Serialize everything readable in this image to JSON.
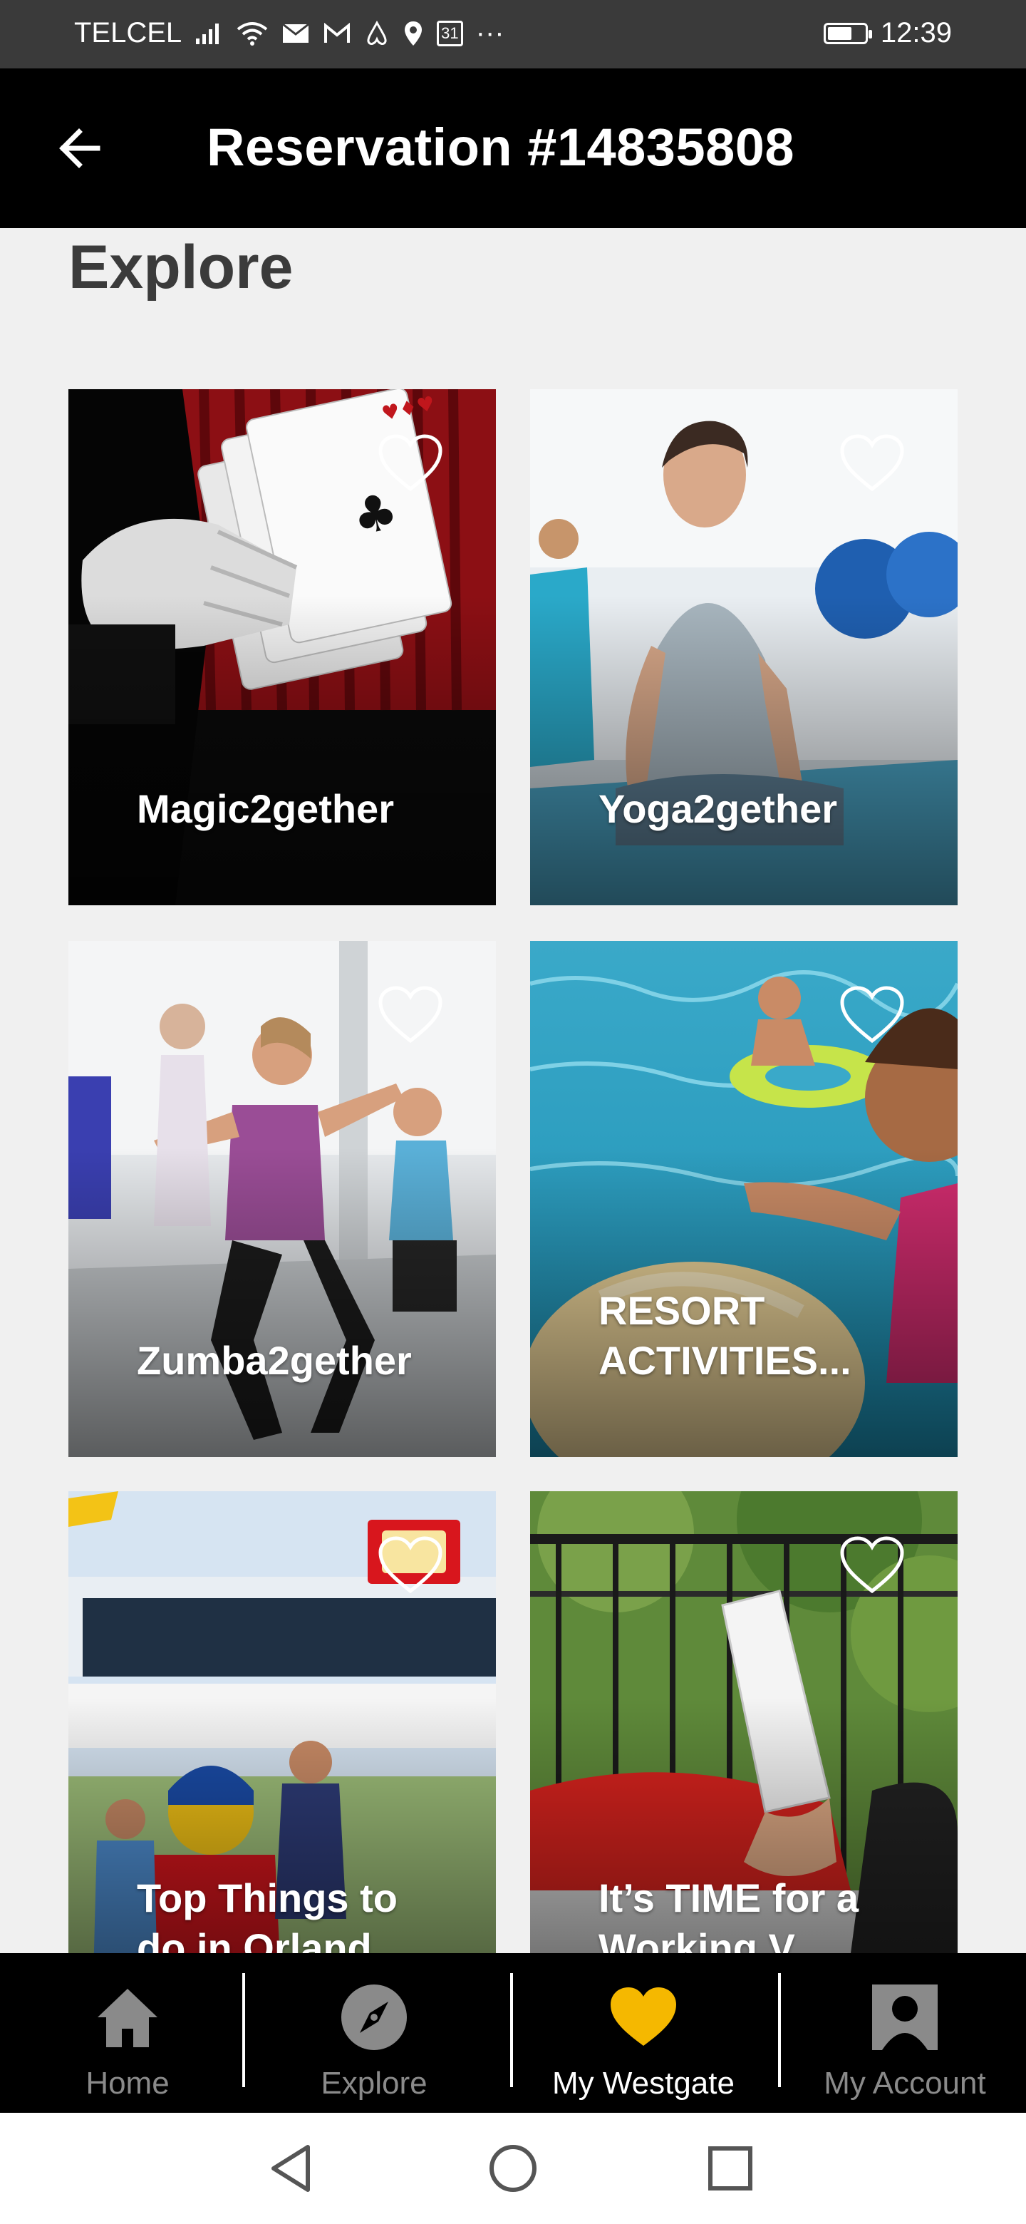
{
  "status_bar": {
    "carrier": "TELCEL",
    "calendar_day": "31",
    "overflow": "···",
    "time": "12:39",
    "battery_level": 0.6
  },
  "app_bar": {
    "title": "Reservation #14835808",
    "back_icon": "arrow-left-icon"
  },
  "explore": {
    "heading": "Explore",
    "cards": [
      {
        "label": "Magic2gether",
        "image": "magician-cards-photo",
        "favorite_icon": "heart-outline-icon"
      },
      {
        "label": "Yoga2gether",
        "image": "yoga-class-photo",
        "favorite_icon": "heart-outline-icon"
      },
      {
        "label": "Zumba2gether",
        "image": "zumba-dance-photo",
        "favorite_icon": "heart-outline-icon"
      },
      {
        "label": "RESORT ACTIVITIES...",
        "image": "pool-kids-photo",
        "favorite_icon": "heart-outline-icon"
      },
      {
        "label": "Top Things to do in Orland...",
        "image": "legoland-photo",
        "favorite_icon": "heart-outline-icon"
      },
      {
        "label": "It’s TIME for a Working V...",
        "image": "reading-balcony-photo",
        "favorite_icon": "heart-outline-icon"
      }
    ]
  },
  "bottom_nav": {
    "items": [
      {
        "label": "Home",
        "icon": "home-icon",
        "active": false
      },
      {
        "label": "Explore",
        "icon": "compass-icon",
        "active": false
      },
      {
        "label": "My Westgate",
        "icon": "heart-filled-icon",
        "active": true
      },
      {
        "label": "My Account",
        "icon": "account-icon",
        "active": false
      }
    ],
    "accent_color": "#f5b800",
    "inactive_color": "#8a8a8a"
  },
  "system_nav": {
    "buttons": [
      "back-triangle-icon",
      "home-circle-icon",
      "recents-square-icon"
    ]
  }
}
